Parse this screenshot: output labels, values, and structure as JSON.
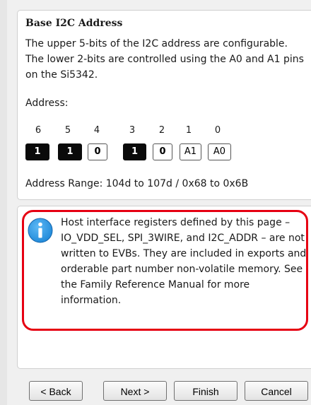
{
  "address_section": {
    "title": "Base I2C Address",
    "description": "The upper 5-bits of the I2C address are configurable. The lower 2-bits are controlled using the A0 and A1 pins on the Si5342.",
    "address_label": "Address:",
    "bit_numbers": [
      "6",
      "5",
      "4",
      "3",
      "2",
      "1",
      "0"
    ],
    "bits": [
      {
        "value": "1",
        "state": "on"
      },
      {
        "value": "1",
        "state": "on"
      },
      {
        "value": "0",
        "state": "off"
      },
      {
        "value": "1",
        "state": "on"
      },
      {
        "value": "0",
        "state": "off"
      },
      {
        "value": "A1",
        "state": "pin"
      },
      {
        "value": "A0",
        "state": "pin"
      }
    ],
    "address_range": "Address Range:  104d to 107d / 0x68 to 0x6B"
  },
  "info_section": {
    "icon": "info-icon",
    "text": "Host interface registers defined by this page – IO_VDD_SEL, SPI_3WIRE, and I2C_ADDR – are not written to EVBs. They are included in exports and orderable part number non-volatile memory. See the Family Reference Manual for more information.",
    "highlight_color": "#e60012",
    "icon_color": "#1e88d8"
  },
  "buttons": {
    "back": "< Back",
    "next": "Next >",
    "finish": "Finish",
    "cancel": "Cancel"
  }
}
